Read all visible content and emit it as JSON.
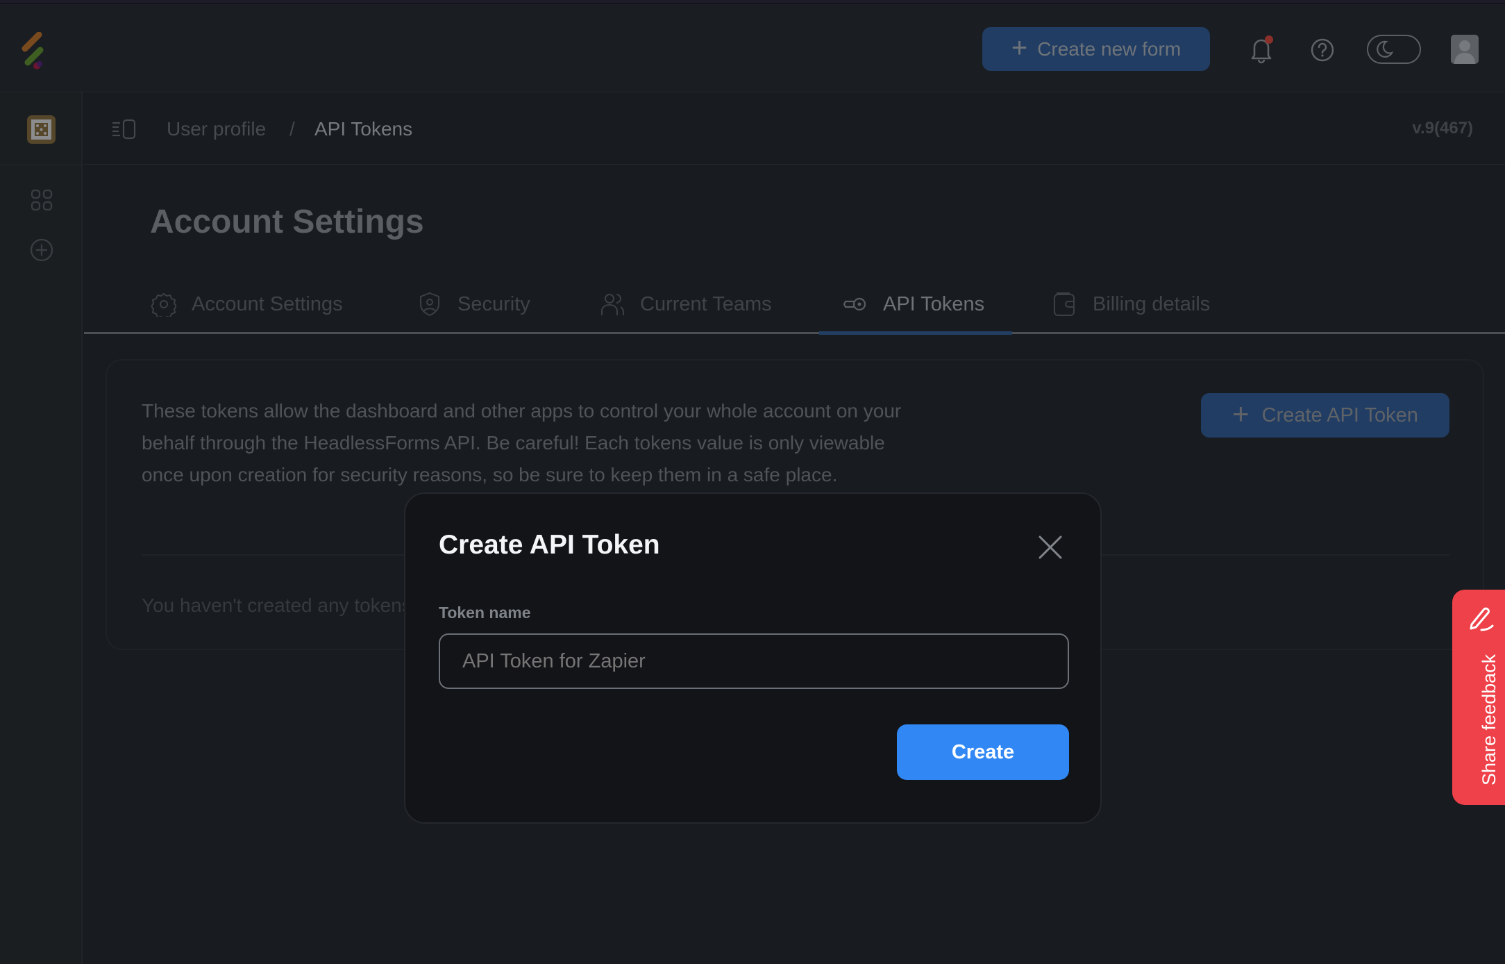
{
  "topbar": {
    "create_form_label": "Create new form",
    "notification_badge_color": "#b23b33",
    "accent_color": "#3188f5"
  },
  "breadcrumb": {
    "items": [
      "User profile",
      "API Tokens"
    ],
    "separator": "/"
  },
  "version": "v.9(467)",
  "page": {
    "title": "Account Settings",
    "tabs": [
      {
        "label": "Account Settings",
        "icon": "gear-icon",
        "active": false
      },
      {
        "label": "Security",
        "icon": "shield-user-icon",
        "active": false
      },
      {
        "label": "Current Teams",
        "icon": "users-icon",
        "active": false
      },
      {
        "label": "API Tokens",
        "icon": "key-icon",
        "active": true
      },
      {
        "label": "Billing details",
        "icon": "wallet-icon",
        "active": false
      }
    ]
  },
  "card": {
    "description": "These tokens allow the dashboard and other apps to control your whole account on your behalf through the HeadlessForms API. Be careful! Each tokens value is only viewable once upon creation for security reasons, so be sure to keep them in a safe place.",
    "create_button_label": "Create API Token",
    "empty_state": "You haven't created any tokens yet."
  },
  "modal": {
    "title": "Create API Token",
    "field_label": "Token name",
    "field_placeholder": "API Token for Zapier",
    "field_value": "",
    "submit_label": "Create"
  },
  "feedback": {
    "label": "Share feedback",
    "color": "#ee4149"
  }
}
